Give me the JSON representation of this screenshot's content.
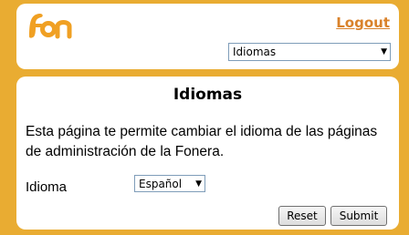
{
  "header": {
    "logo_text": "fon",
    "logout_label": "Logout",
    "nav_select_value": "Idiomas"
  },
  "main": {
    "title": "Idiomas",
    "description": "Esta página te permite cambiar el idioma de las páginas de administración de la Fonera.",
    "language_label": "Idioma",
    "language_select_value": "Español",
    "reset_label": "Reset",
    "submit_label": "Submit"
  },
  "colors": {
    "background": "#e9ac32",
    "accent": "#d9822b",
    "logo": "#f0a023"
  },
  "icons": [
    "fon-logo",
    "chevron-down-icon"
  ]
}
